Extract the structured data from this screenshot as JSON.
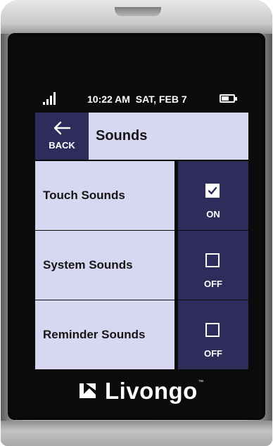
{
  "status_bar": {
    "time": "10:22 AM",
    "date": "SAT, FEB 7",
    "signal_icon": "signal-bars-icon",
    "battery_icon": "battery-icon",
    "battery_level": 0.6
  },
  "header": {
    "back_label": "BACK",
    "back_icon": "arrow-left-icon",
    "title": "Sounds"
  },
  "settings": [
    {
      "label": "Touch Sounds",
      "checked": true,
      "state": "ON"
    },
    {
      "label": "System Sounds",
      "checked": false,
      "state": "OFF"
    },
    {
      "label": "Reminder Sounds",
      "checked": false,
      "state": "OFF"
    }
  ],
  "brand": {
    "name": "Livongo",
    "trademark": "™"
  },
  "colors": {
    "toggle_background": "#2e2c5a",
    "label_background": "#d7d7f1",
    "screen_background": "#0b0b0b",
    "text_light": "#ffffff",
    "text_dark": "#161616"
  }
}
